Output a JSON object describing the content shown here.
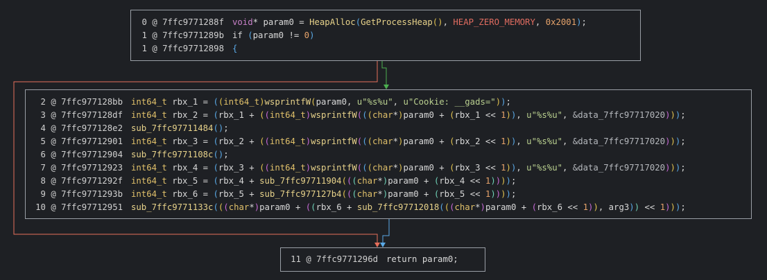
{
  "blocks": {
    "entry": {
      "lines": [
        {
          "addr": "0 @ 7ffc9771288f",
          "code": [
            [
              "void",
              "kw"
            ],
            [
              "* ",
              "var"
            ],
            [
              "param0",
              "var"
            ],
            [
              " = ",
              "var"
            ],
            [
              "HeapAlloc",
              "fn"
            ],
            [
              "(",
              "p1"
            ],
            [
              "GetProcessHeap",
              "fn"
            ],
            [
              "()",
              "p2"
            ],
            [
              ", ",
              "var"
            ],
            [
              "HEAP_ZERO_MEMORY",
              "cst"
            ],
            [
              ", ",
              "var"
            ],
            [
              "0x2001",
              "num"
            ],
            [
              ")",
              "p1"
            ],
            [
              ";",
              "var"
            ]
          ]
        },
        {
          "addr": "1 @ 7ffc9771289b",
          "code": [
            [
              "if ",
              "var"
            ],
            [
              "(",
              "p1"
            ],
            [
              "param0 != ",
              "var"
            ],
            [
              "0",
              "num"
            ],
            [
              ")",
              "p1"
            ]
          ]
        },
        {
          "addr": "1 @ 7ffc97712898",
          "code": [
            [
              "{",
              "p1"
            ]
          ]
        }
      ]
    },
    "body": {
      "lines": [
        {
          "addr": "2 @ 7ffc977128bb",
          "code": [
            [
              "int64_t ",
              "ty"
            ],
            [
              "rbx_1 = ",
              "var"
            ],
            [
              "(",
              "p1"
            ],
            [
              "(",
              "p2"
            ],
            [
              "int64_t",
              "ty"
            ],
            [
              ")",
              "p2"
            ],
            [
              "wsprintfW",
              "fn"
            ],
            [
              "(",
              "p2"
            ],
            [
              "param0, ",
              "var"
            ],
            [
              "u\"%s%u\"",
              "str"
            ],
            [
              ", ",
              "var"
            ],
            [
              "u\"Cookie: __gads=\"",
              "str"
            ],
            [
              ")",
              "p2"
            ],
            [
              ")",
              "p1"
            ],
            [
              ";",
              "var"
            ]
          ]
        },
        {
          "addr": "3 @ 7ffc977128df",
          "code": [
            [
              "int64_t ",
              "ty"
            ],
            [
              "rbx_2 = ",
              "var"
            ],
            [
              "(",
              "p1"
            ],
            [
              "rbx_1 + ",
              "var"
            ],
            [
              "(",
              "p2"
            ],
            [
              "(",
              "p3"
            ],
            [
              "int64_t",
              "ty"
            ],
            [
              ")",
              "p3"
            ],
            [
              "wsprintfW",
              "fn"
            ],
            [
              "(",
              "p3"
            ],
            [
              "(",
              "p1"
            ],
            [
              "(",
              "p2"
            ],
            [
              "char",
              "ty"
            ],
            [
              "*",
              "var"
            ],
            [
              ")",
              "p2"
            ],
            [
              "param0 + ",
              "var"
            ],
            [
              "(",
              "p2"
            ],
            [
              "rbx_1 << ",
              "var"
            ],
            [
              "1",
              "num"
            ],
            [
              ")",
              "p2"
            ],
            [
              ")",
              "p1"
            ],
            [
              ", ",
              "var"
            ],
            [
              "u\"%s%u\"",
              "str"
            ],
            [
              ", ",
              "var"
            ],
            [
              "&data_7ffc97717020",
              "sym"
            ],
            [
              ")",
              "p3"
            ],
            [
              ")",
              "p2"
            ],
            [
              ")",
              "p1"
            ],
            [
              ";",
              "var"
            ]
          ]
        },
        {
          "addr": "4 @ 7ffc977128e2",
          "code": [
            [
              "sub_7ffc97711484",
              "fn"
            ],
            [
              "()",
              "p1"
            ],
            [
              ";",
              "var"
            ]
          ]
        },
        {
          "addr": "5 @ 7ffc97712901",
          "code": [
            [
              "int64_t ",
              "ty"
            ],
            [
              "rbx_3 = ",
              "var"
            ],
            [
              "(",
              "p1"
            ],
            [
              "rbx_2 + ",
              "var"
            ],
            [
              "(",
              "p2"
            ],
            [
              "(",
              "p3"
            ],
            [
              "int64_t",
              "ty"
            ],
            [
              ")",
              "p3"
            ],
            [
              "wsprintfW",
              "fn"
            ],
            [
              "(",
              "p3"
            ],
            [
              "(",
              "p1"
            ],
            [
              "(",
              "p2"
            ],
            [
              "char",
              "ty"
            ],
            [
              "*",
              "var"
            ],
            [
              ")",
              "p2"
            ],
            [
              "param0 + ",
              "var"
            ],
            [
              "(",
              "p2"
            ],
            [
              "rbx_2 << ",
              "var"
            ],
            [
              "1",
              "num"
            ],
            [
              ")",
              "p2"
            ],
            [
              ")",
              "p1"
            ],
            [
              ", ",
              "var"
            ],
            [
              "u\"%s%u\"",
              "str"
            ],
            [
              ", ",
              "var"
            ],
            [
              "&data_7ffc97717020",
              "sym"
            ],
            [
              ")",
              "p3"
            ],
            [
              ")",
              "p2"
            ],
            [
              ")",
              "p1"
            ],
            [
              ";",
              "var"
            ]
          ]
        },
        {
          "addr": "6 @ 7ffc97712904",
          "code": [
            [
              "sub_7ffc9771108c",
              "fn"
            ],
            [
              "()",
              "p1"
            ],
            [
              ";",
              "var"
            ]
          ]
        },
        {
          "addr": "7 @ 7ffc97712923",
          "code": [
            [
              "int64_t ",
              "ty"
            ],
            [
              "rbx_4 = ",
              "var"
            ],
            [
              "(",
              "p1"
            ],
            [
              "rbx_3 + ",
              "var"
            ],
            [
              "(",
              "p2"
            ],
            [
              "(",
              "p3"
            ],
            [
              "int64_t",
              "ty"
            ],
            [
              ")",
              "p3"
            ],
            [
              "wsprintfW",
              "fn"
            ],
            [
              "(",
              "p3"
            ],
            [
              "(",
              "p1"
            ],
            [
              "(",
              "p2"
            ],
            [
              "char",
              "ty"
            ],
            [
              "*",
              "var"
            ],
            [
              ")",
              "p2"
            ],
            [
              "param0 + ",
              "var"
            ],
            [
              "(",
              "p2"
            ],
            [
              "rbx_3 << ",
              "var"
            ],
            [
              "1",
              "num"
            ],
            [
              ")",
              "p2"
            ],
            [
              ")",
              "p1"
            ],
            [
              ", ",
              "var"
            ],
            [
              "u\"%s%u\"",
              "str"
            ],
            [
              ", ",
              "var"
            ],
            [
              "&data_7ffc97717020",
              "sym"
            ],
            [
              ")",
              "p3"
            ],
            [
              ")",
              "p2"
            ],
            [
              ")",
              "p1"
            ],
            [
              ";",
              "var"
            ]
          ]
        },
        {
          "addr": "8 @ 7ffc9771292f",
          "code": [
            [
              "int64_t ",
              "ty"
            ],
            [
              "rbx_5 = ",
              "var"
            ],
            [
              "(",
              "p1"
            ],
            [
              "rbx_4 + ",
              "var"
            ],
            [
              "sub_7ffc97711904",
              "fn"
            ],
            [
              "(",
              "p2"
            ],
            [
              "(",
              "p3"
            ],
            [
              "(",
              "p4"
            ],
            [
              "char",
              "ty"
            ],
            [
              "*",
              "var"
            ],
            [
              ")",
              "p4"
            ],
            [
              "param0 + ",
              "var"
            ],
            [
              "(",
              "p4"
            ],
            [
              "rbx_4 << ",
              "var"
            ],
            [
              "1",
              "num"
            ],
            [
              ")",
              "p4"
            ],
            [
              ")",
              "p3"
            ],
            [
              ")",
              "p2"
            ],
            [
              ")",
              "p1"
            ],
            [
              ";",
              "var"
            ]
          ]
        },
        {
          "addr": "9 @ 7ffc9771293b",
          "code": [
            [
              "int64_t ",
              "ty"
            ],
            [
              "rbx_6 = ",
              "var"
            ],
            [
              "(",
              "p1"
            ],
            [
              "rbx_5 + ",
              "var"
            ],
            [
              "sub_7ffc977127b4",
              "fn"
            ],
            [
              "(",
              "p2"
            ],
            [
              "(",
              "p3"
            ],
            [
              "(",
              "p4"
            ],
            [
              "char",
              "ty"
            ],
            [
              "*",
              "var"
            ],
            [
              ")",
              "p4"
            ],
            [
              "param0 + ",
              "var"
            ],
            [
              "(",
              "p4"
            ],
            [
              "rbx_5 << ",
              "var"
            ],
            [
              "1",
              "num"
            ],
            [
              ")",
              "p4"
            ],
            [
              ")",
              "p3"
            ],
            [
              ")",
              "p2"
            ],
            [
              ")",
              "p1"
            ],
            [
              ";",
              "var"
            ]
          ]
        },
        {
          "addr": "10 @ 7ffc97712951",
          "code": [
            [
              "sub_7ffc9771133c",
              "fn"
            ],
            [
              "(",
              "p1"
            ],
            [
              "(",
              "p2"
            ],
            [
              "(",
              "p3"
            ],
            [
              "char",
              "ty"
            ],
            [
              "*",
              "var"
            ],
            [
              ")",
              "p3"
            ],
            [
              "param0 + ",
              "var"
            ],
            [
              "(",
              "p3"
            ],
            [
              "(",
              "p4"
            ],
            [
              "rbx_6 + ",
              "var"
            ],
            [
              "sub_7ffc97712018",
              "fn"
            ],
            [
              "(",
              "p1"
            ],
            [
              "(",
              "p2"
            ],
            [
              "(",
              "p3"
            ],
            [
              "char",
              "ty"
            ],
            [
              "*",
              "var"
            ],
            [
              ")",
              "p3"
            ],
            [
              "param0 + ",
              "var"
            ],
            [
              "(",
              "p3"
            ],
            [
              "rbx_6 << ",
              "var"
            ],
            [
              "1",
              "num"
            ],
            [
              ")",
              "p3"
            ],
            [
              ")",
              "p2"
            ],
            [
              ", ",
              "var"
            ],
            [
              "arg3",
              "var"
            ],
            [
              ")",
              "p1"
            ],
            [
              ")",
              "p4"
            ],
            [
              " << ",
              "var"
            ],
            [
              "1",
              "num"
            ],
            [
              ")",
              "p3"
            ],
            [
              ")",
              "p2"
            ],
            [
              ")",
              "p1"
            ],
            [
              ";",
              "var"
            ]
          ]
        }
      ]
    },
    "exit": {
      "lines": [
        {
          "addr": "11 @ 7ffc9771296d",
          "code": [
            [
              "return ",
              "var"
            ],
            [
              "param0",
              "var"
            ],
            [
              ";",
              "var"
            ]
          ]
        }
      ]
    }
  },
  "colors": {
    "background": "#1e2024",
    "block_border": "#9a9fa6",
    "edge_true": "#4caf50",
    "edge_false": "#e76f5c",
    "edge_unconditional": "#5aa9e6"
  }
}
